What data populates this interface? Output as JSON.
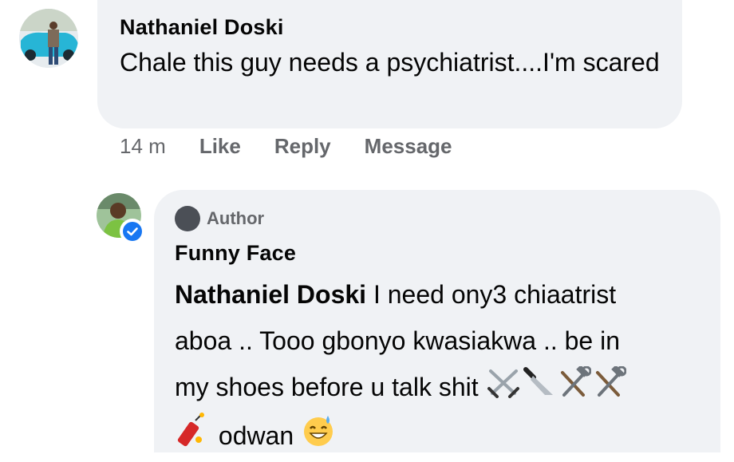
{
  "comment": {
    "author": "Nathaniel Doski",
    "text": "Chale this guy needs a psychiatrist....I'm scared",
    "time": "14 m",
    "actions": [
      "Like",
      "Reply",
      "Message"
    ]
  },
  "reply": {
    "badge": "Author",
    "author": "Funny Face",
    "mention": "Nathaniel Doski",
    "text_line1": " I need ony3 chiaatrist",
    "text_line2": "aboa .. Tooo gbonyo kwasiakwa .. be in",
    "text_line3": "my shoes before u talk shit",
    "text_line4": "odwan",
    "icons": [
      "crossed-swords-icon",
      "knife-icon",
      "hammer-and-wrench-icon",
      "hammer-and-wrench-icon",
      "firecracker-icon",
      "grinning-sweat-face-icon"
    ]
  },
  "colors": {
    "bubble": "#f0f2f5",
    "secondary_text": "#65676b",
    "verified": "#1877f2"
  }
}
